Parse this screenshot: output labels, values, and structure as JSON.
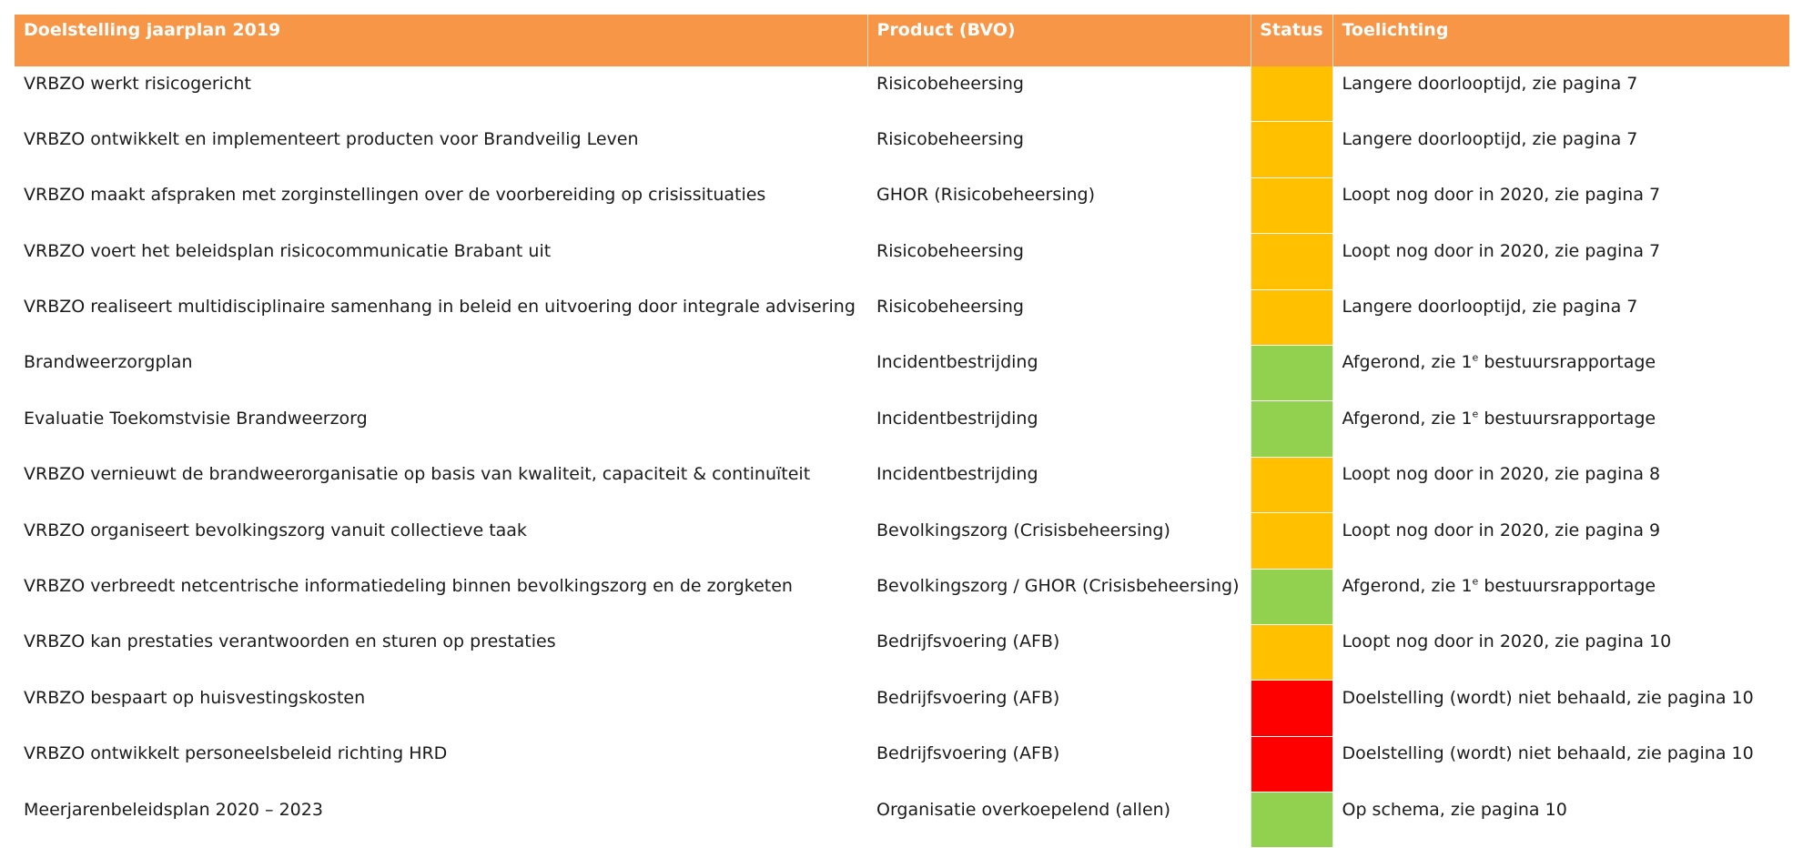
{
  "colors": {
    "header_bg": "#f79646",
    "header_text": "#ffffff",
    "orange": "#ffc000",
    "green": "#92d050",
    "red": "#ff0000"
  },
  "table": {
    "headers": {
      "goal": "Doelstelling jaarplan 2019",
      "product": "Product (BVO)",
      "status": "Status",
      "remark": "Toelichting"
    },
    "rows": [
      {
        "goal": "VRBZO werkt risicogericht",
        "product": "Risicobeheersing",
        "status": "orange",
        "remark": "Langere doorlooptijd, zie pagina 7"
      },
      {
        "goal": "VRBZO ontwikkelt en implementeert producten voor Brandveilig Leven",
        "product": "Risicobeheersing",
        "status": "orange",
        "remark": "Langere doorlooptijd, zie pagina 7"
      },
      {
        "goal": "VRBZO maakt afspraken met zorginstellingen over de voorbereiding op crisissituaties",
        "product": "GHOR (Risicobeheersing)",
        "status": "orange",
        "remark": "Loopt nog door in 2020, zie pagina 7"
      },
      {
        "goal": "VRBZO voert het beleidsplan risicocommunicatie Brabant uit",
        "product": "Risicobeheersing",
        "status": "orange",
        "remark": "Loopt nog door in 2020, zie pagina 7"
      },
      {
        "goal": "VRBZO realiseert multidisciplinaire samenhang in beleid en uitvoering door integrale advisering",
        "product": "Risicobeheersing",
        "status": "orange",
        "remark": "Langere doorlooptijd, zie pagina 7"
      },
      {
        "goal": "Brandweerzorgplan",
        "product": "Incidentbestrijding",
        "status": "green",
        "remark_pre": "Afgerond, zie 1",
        "remark_sup": "e",
        "remark_post": " bestuursrapportage"
      },
      {
        "goal": "Evaluatie Toekomstvisie Brandweerzorg",
        "product": "Incidentbestrijding",
        "status": "green",
        "remark_pre": "Afgerond, zie 1",
        "remark_sup": "e",
        "remark_post": " bestuursrapportage"
      },
      {
        "goal": "VRBZO vernieuwt de brandweerorganisatie op basis van kwaliteit, capaciteit & continuïteit",
        "product": "Incidentbestrijding",
        "status": "orange",
        "remark": "Loopt nog door in 2020, zie pagina 8"
      },
      {
        "goal": "VRBZO organiseert bevolkingszorg vanuit collectieve taak",
        "product": "Bevolkingszorg (Crisisbeheersing)",
        "status": "orange",
        "remark": "Loopt nog door in 2020, zie pagina 9"
      },
      {
        "goal": "VRBZO verbreedt netcentrische informatiedeling binnen bevolkingszorg en de zorgketen",
        "product": "Bevolkingszorg / GHOR (Crisisbeheersing)",
        "status": "green",
        "remark_pre": "Afgerond, zie 1",
        "remark_sup": "e",
        "remark_post": " bestuursrapportage"
      },
      {
        "goal": "VRBZO kan prestaties verantwoorden en sturen op prestaties",
        "product": "Bedrijfsvoering (AFB)",
        "status": "orange",
        "remark": "Loopt nog door in 2020, zie pagina 10"
      },
      {
        "goal": "VRBZO bespaart op huisvestingskosten",
        "product": "Bedrijfsvoering (AFB)",
        "status": "red",
        "remark": "Doelstelling (wordt) niet behaald, zie pagina 10"
      },
      {
        "goal": "VRBZO ontwikkelt personeelsbeleid richting HRD",
        "product": "Bedrijfsvoering (AFB)",
        "status": "red",
        "remark": "Doelstelling (wordt) niet behaald, zie pagina 10"
      },
      {
        "goal": "Meerjarenbeleidsplan 2020 – 2023",
        "product": "Organisatie overkoepelend (allen)",
        "status": "green",
        "remark": "Op schema, zie pagina 10"
      }
    ]
  }
}
